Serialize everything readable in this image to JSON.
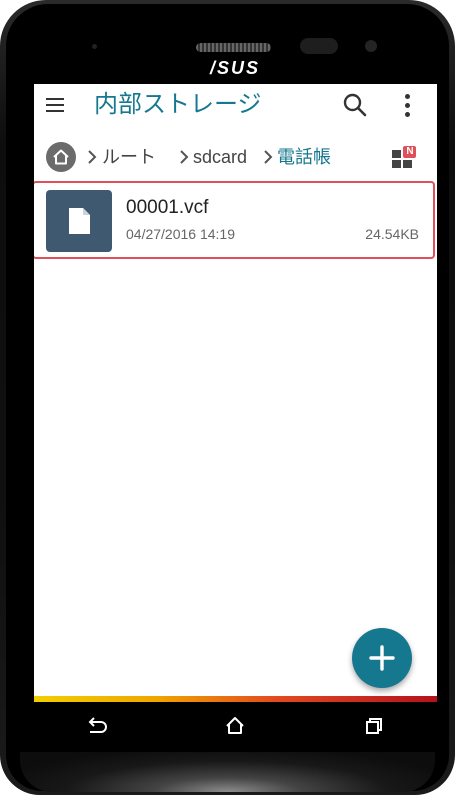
{
  "device": {
    "brand": "/SUS"
  },
  "app": {
    "title": "内部ストレージ",
    "accent_color": "#16788f",
    "icons": {
      "menu": "hamburger-menu-icon",
      "search": "search-icon",
      "more": "more-vertical-icon",
      "home": "home-icon",
      "view_toggle": "grid-view-icon",
      "add": "plus-icon"
    }
  },
  "breadcrumb": {
    "items": [
      {
        "label": "ルート",
        "active": false
      },
      {
        "label": "sdcard",
        "active": false
      },
      {
        "label": "電話帳",
        "active": true
      }
    ],
    "view_toggle_badge": "N"
  },
  "files": [
    {
      "name": "00001.vcf",
      "modified": "04/27/2016 14:19",
      "size": "24.54KB",
      "selected": true
    }
  ],
  "navbar": {
    "buttons": [
      "back-icon",
      "home-icon",
      "recent-apps-icon"
    ]
  },
  "colors": {
    "highlight_border": "#e0505a",
    "file_icon_bg": "#3f5a70"
  }
}
